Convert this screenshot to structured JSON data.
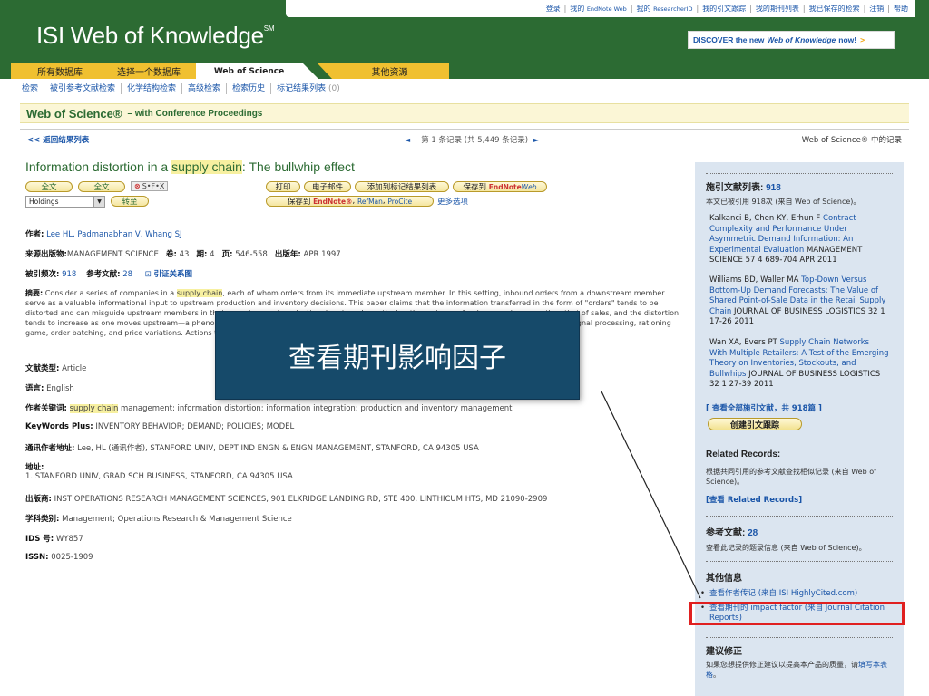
{
  "toplinks": {
    "items": [
      {
        "label": "登录",
        "small": false
      },
      {
        "label": "我的 ",
        "suffix": "EndNote Web"
      },
      {
        "label": "我的 ",
        "suffix": "ResearcherID"
      },
      {
        "label": "我的引文跟踪"
      },
      {
        "label": "我的期刊列表"
      },
      {
        "label": "我已保存的检索"
      },
      {
        "label": "注销"
      },
      {
        "label": "帮助"
      }
    ]
  },
  "brand": {
    "logo": "ISI Web of Knowledge",
    "logo_mark": "SM",
    "discover_pre": "DISCOVER the new",
    "discover_em": "Web of Knowledge",
    "discover_post": "now!",
    "discover_arrow": ">"
  },
  "tabs": {
    "all": "所有数据库",
    "select": "选择一个数据库",
    "wos": "Web of Science",
    "other": "其他资源"
  },
  "subnav": {
    "items": [
      "检索",
      "被引参考文献检索",
      "化学结构检索",
      "高级检索",
      "检索历史"
    ],
    "marked": "标记结果列表",
    "marked_count": "(0)"
  },
  "wosbar": {
    "name": "Web of Science",
    "reg": "®",
    "sub": "– with Conference Proceedings"
  },
  "resnav": {
    "back": "<< 返回结果列表",
    "prev": "◄",
    "pager": "第 1 条记录 (共 5,449 条记录)",
    "next": "►",
    "in_db": "Web of Science® 中的记录"
  },
  "record": {
    "title_pre": "Information distortion in a ",
    "title_hl": "supply chain",
    "title_post": ": The bullwhip effect",
    "buttons": {
      "fulltext1": "全文",
      "fulltext2": "全文",
      "sfx": "S•F•X",
      "sfx_mark": "⊗",
      "holdings": "Holdings",
      "go": "转至",
      "print": "打印",
      "email": "电子邮件",
      "add_marked": "添加到标记结果列表",
      "save_to": "保存到",
      "endnote": "EndNote",
      "endnote_web": "Web",
      "save_to2": "保存到",
      "endnote2": "EndNote®",
      "refman": "RefMan",
      "procite": "ProCite",
      "more": "更多选项"
    },
    "authors_lbl": "作者:",
    "authors": "Lee HL, Padmanabhan V, Whang SJ",
    "source_lbl": "来源出版物:",
    "source": "MANAGEMENT SCIENCE",
    "vol_lbl": "卷:",
    "vol": "43",
    "iss_lbl": "期:",
    "iss": "4",
    "pages_lbl": "页:",
    "pages": "546-558",
    "date_lbl": "出版年:",
    "date": "APR 1997",
    "timescited_lbl": "被引频次:",
    "timescited": "918",
    "refs_lbl": "参考文献:",
    "refs": "28",
    "citemap": "引证关系图",
    "abstract_lbl": "摘要:",
    "abstract_a": "Consider a series of companies in a ",
    "abstract_hl": "supply chain",
    "abstract_b": ", each of whom orders from its immediate upstream member. In this setting, inbound orders from a downstream member serve as a valuable informational input to upstream production and inventory decisions. This paper claims that the information transferred in the form of \"orders\" tends to be distorted and can misguide upstream members in their inventory and production decisions. In particular, the variance of orders may be larger than that of sales, and the distortion tends to increase as one moves upstream—a phenomenon termed \"bullwhip effect.\" This paper analyzes four sources of the bullwhip effect: demand signal processing, rationing game, order batching, and price variations. Actions that can be taken to mitigate the detrimental impact of this distortion are also discussed.",
    "doctype_lbl": "文献类型:",
    "doctype": "Article",
    "lang_lbl": "语言:",
    "lang": "English",
    "keywords_lbl": "作者关键词:",
    "keywords_hl": "supply chain",
    "keywords": " management; information distortion; information integration; production and inventory management",
    "kwplus_lbl": "KeyWords Plus:",
    "kwplus": "INVENTORY BEHAVIOR; DEMAND; POLICIES; MODEL",
    "reprint_lbl": "通讯作者地址:",
    "reprint": "Lee, HL (通讯作者), STANFORD UNIV, DEPT IND ENGN & ENGN MANAGEMENT, STANFORD, CA 94305 USA",
    "addr_lbl": "地址:",
    "addr": "1. STANFORD UNIV, GRAD SCH BUSINESS, STANFORD, CA 94305 USA",
    "publisher_lbl": "出版商:",
    "publisher": "INST OPERATIONS RESEARCH MANAGEMENT SCIENCES, 901 ELKRIDGE LANDING RD, STE 400, LINTHICUM HTS, MD 21090-2909",
    "subject_lbl": "学科类别:",
    "subject": "Management; Operations Research & Management Science",
    "ids_lbl": "IDS 号:",
    "ids": "WY857",
    "issn_lbl": "ISSN:",
    "issn": "0025-1909"
  },
  "sidebar": {
    "citing_title": "施引文献列表:",
    "citing_count": "918",
    "citing_note": "本文已被引用 918次 (来自 Web of Science)。",
    "cites": [
      {
        "authors": "Kalkanci B, Chen KY, Erhun F",
        "title": "Contract Complexity and Performance Under Asymmetric Demand Information: An Experimental Evaluation",
        "source": "MANAGEMENT SCIENCE 57 4 689-704 APR 2011"
      },
      {
        "authors": "Williams BD, Waller MA",
        "title": "Top-Down Versus Bottom-Up Demand Forecasts: The Value of Shared Point-of-Sale Data in the Retail Supply Chain",
        "source": "JOURNAL OF BUSINESS LOGISTICS 32 1 17-26 2011"
      },
      {
        "authors": "Wan XA, Evers PT",
        "title": "Supply Chain Networks With Multiple Retailers: A Test of the Emerging Theory on Inventories, Stockouts, and Bullwhips",
        "source": "JOURNAL OF BUSINESS LOGISTICS 32 1 27-39 2011"
      }
    ],
    "view_all": "[ 查看全部施引文献，共 918篇 ]",
    "alert": "创建引文跟踪",
    "related_title": "Related Records:",
    "related_note": "根据共同引用的参考文献查找相似记录 (来自 Web of Science)。",
    "related_link": "[查看 Related Records]",
    "refs_title": "参考文献:",
    "refs_count": "28",
    "refs_note": "查看此记录的题录信息 (来自 Web of Science)。",
    "other_title": "其他信息",
    "other_items": [
      "查看作者传记 (来自 ISI HighlyCited.com)",
      "查看期刊的 impact factor (来自 Journal Citation Reports)"
    ],
    "suggest_title": "建议修正",
    "suggest_note_a": "如果您想提供修正建议以提高本产品的质量，请",
    "suggest_link": "填写本表格",
    "suggest_note_b": "。"
  },
  "overlay": {
    "caption": "查看期刊影响因子"
  },
  "colors": {
    "header_green": "#2c6b33",
    "tab_gold": "#f0c030",
    "link_blue": "#1a55a8",
    "sidebar_bg": "#dbe5f0",
    "overlay_bg": "#164a6a",
    "highlight_red": "#e02020"
  }
}
